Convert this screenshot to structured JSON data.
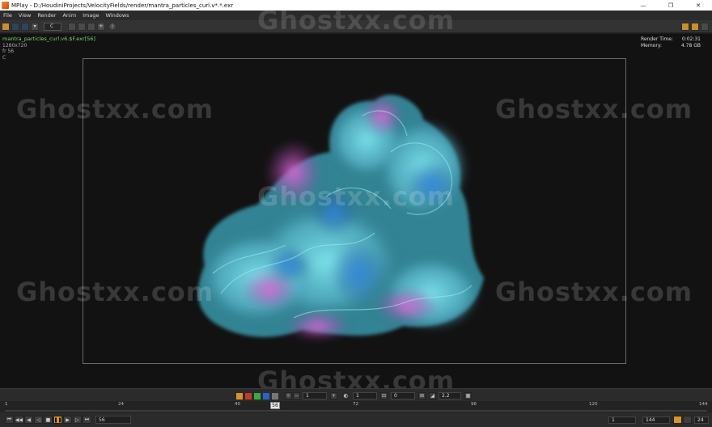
{
  "window": {
    "title": "MPlay - D:/HoudiniProjects/VelocityFields/render/mantra_particles_curl.v*.*.exr",
    "minimize": "—",
    "maximize": "❐",
    "close": "✕"
  },
  "menu": [
    "File",
    "View",
    "Render",
    "Anim",
    "Image",
    "Windows"
  ],
  "toolbar": {
    "channel": "C"
  },
  "viewer": {
    "filename": "mantra_particles_curl.v6.$F.exr[56]",
    "resolution": "1280x720",
    "frame_label": "fr 56",
    "channel_label": "C",
    "render_time_label": "Render Time:",
    "render_time_value": "0:02:31",
    "memory_label": "Memory:",
    "memory_value": "4.78 GB"
  },
  "watermark": "Ghostxx.com",
  "controls": {
    "field1": "1",
    "field2": "1",
    "field3": "0",
    "gamma": "2.2"
  },
  "timeline": {
    "ticks": [
      "1",
      "24",
      "40",
      "72",
      "96",
      "120",
      "144"
    ],
    "current_frame": "56"
  },
  "playbar": {
    "frame_input": "56",
    "range_start": "1",
    "range_end": "144",
    "fps": "24"
  },
  "colors": {
    "accent": "#d8922a",
    "filename": "#7ad86a",
    "smoke_cyan": "#6fd6e0",
    "smoke_magenta": "#d45ad0",
    "smoke_blue": "#2f7fd0"
  }
}
